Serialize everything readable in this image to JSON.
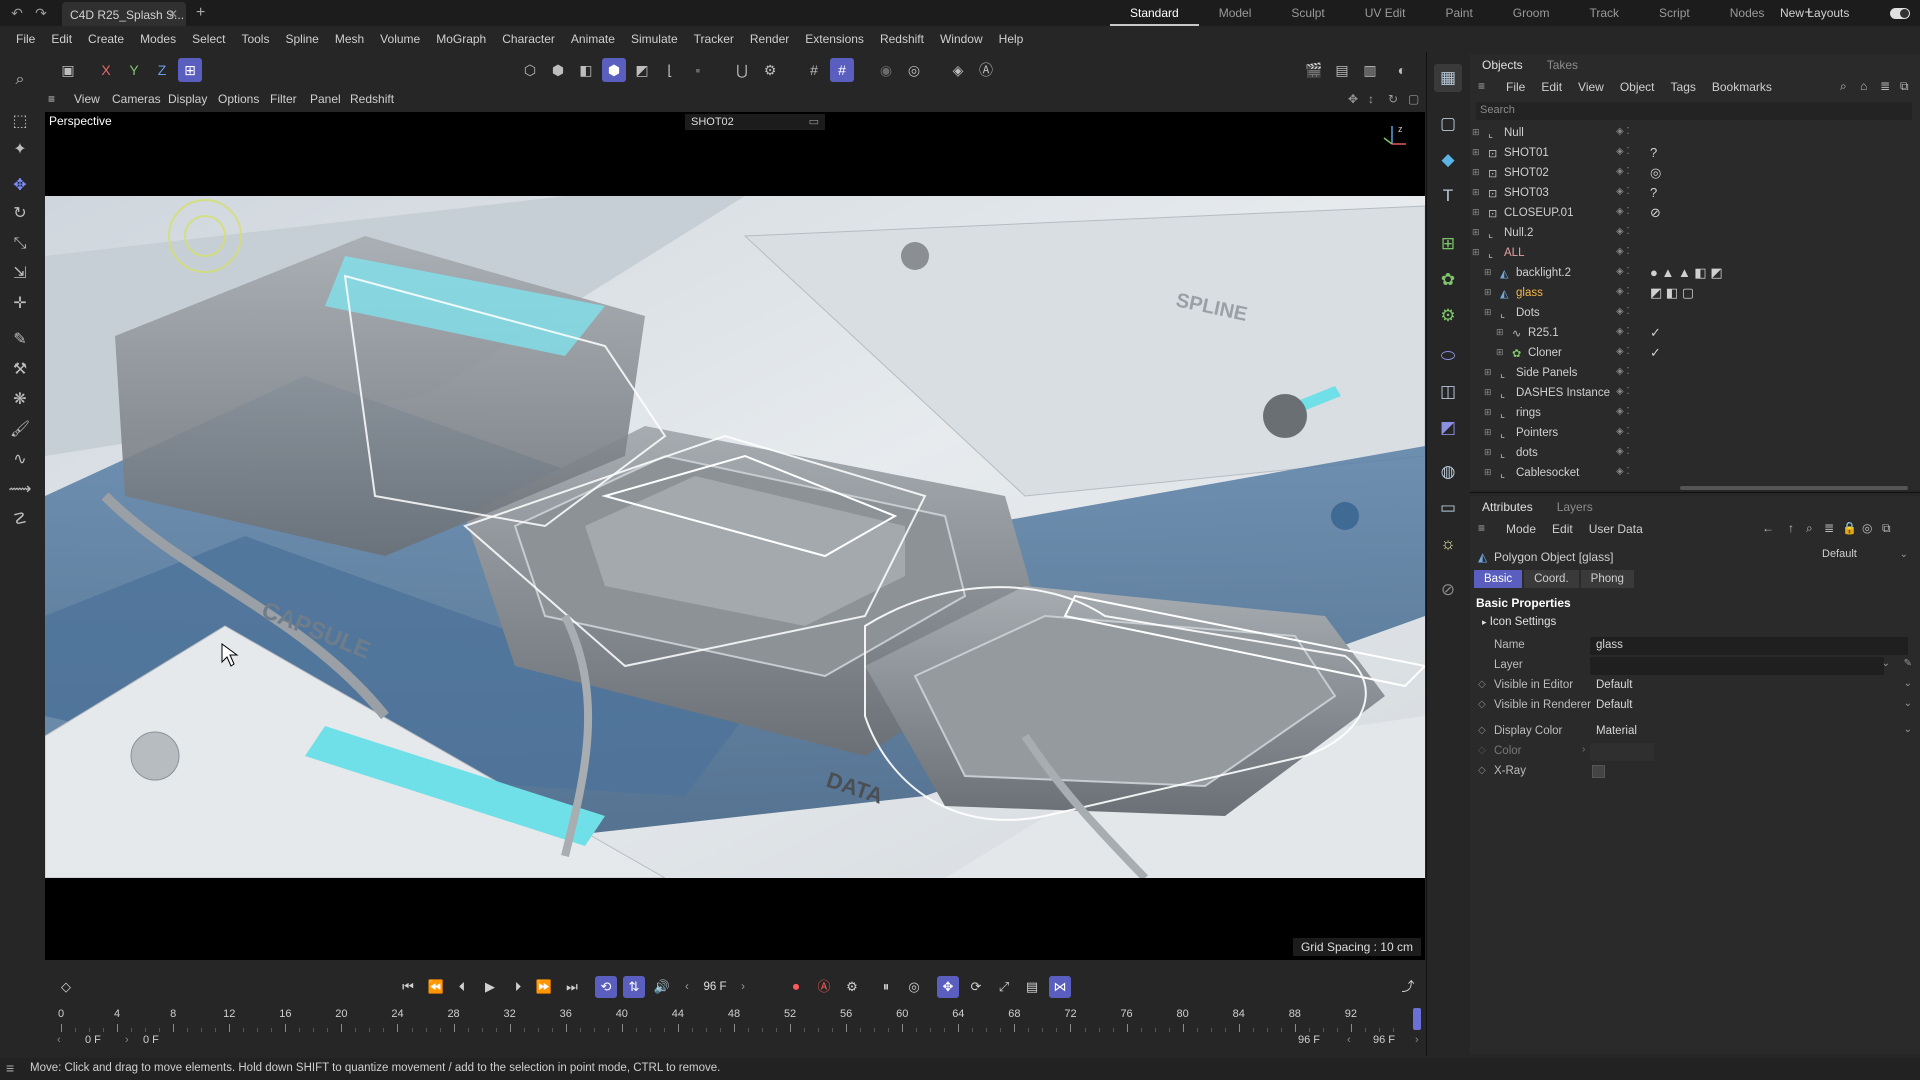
{
  "app": {
    "doc_tab": "C4D R25_Splash S...",
    "layouts": [
      "Standard",
      "Model",
      "Sculpt",
      "UV Edit",
      "Paint",
      "Groom",
      "Track",
      "Script",
      "Nodes"
    ],
    "active_layout": "Standard",
    "new_layouts": "New Layouts"
  },
  "menubar": [
    "File",
    "Edit",
    "Create",
    "Modes",
    "Select",
    "Tools",
    "Spline",
    "Mesh",
    "Volume",
    "MoGraph",
    "Character",
    "Animate",
    "Simulate",
    "Tracker",
    "Render",
    "Extensions",
    "Redshift",
    "Window",
    "Help"
  ],
  "toolbar": {
    "axis_x": "X",
    "axis_y": "Y",
    "axis_z": "Z"
  },
  "viewport": {
    "menu": [
      "View",
      "Cameras",
      "Display",
      "Options",
      "Filter",
      "Panel",
      "Redshift"
    ],
    "label": "Perspective",
    "camera": "SHOT02",
    "grid_spacing": "Grid Spacing : 10 cm",
    "scene_text_1": "CAPSULE",
    "scene_text_2": "DATA",
    "scene_text_3": "SPLINE"
  },
  "objects_panel": {
    "tabs": [
      "Objects",
      "Takes"
    ],
    "menu": [
      "File",
      "Edit",
      "View",
      "Object",
      "Tags",
      "Bookmarks"
    ],
    "search_placeholder": "Search",
    "items": [
      {
        "name": "Null",
        "indent": 0,
        "icon": "null"
      },
      {
        "name": "SHOT01",
        "indent": 0,
        "icon": "camera",
        "tag": "?"
      },
      {
        "name": "SHOT02",
        "indent": 0,
        "icon": "camera",
        "tag": "◎"
      },
      {
        "name": "SHOT03",
        "indent": 0,
        "icon": "camera",
        "tag": "?"
      },
      {
        "name": "CLOSEUP.01",
        "indent": 0,
        "icon": "camera",
        "tag": "⊘"
      },
      {
        "name": "Null.2",
        "indent": 0,
        "icon": "null"
      },
      {
        "name": "ALL",
        "indent": 0,
        "icon": "null",
        "collapsed": false,
        "highlight": true
      },
      {
        "name": "backlight.2",
        "indent": 1,
        "icon": "mesh",
        "tag": "● ▲ ▲ ◧ ◩"
      },
      {
        "name": "glass",
        "indent": 1,
        "icon": "mesh",
        "selected": true,
        "tag": "◩ ◧ ▢"
      },
      {
        "name": "Dots",
        "indent": 1,
        "icon": "null"
      },
      {
        "name": "R25.1",
        "indent": 2,
        "icon": "spline",
        "tag": "✓"
      },
      {
        "name": "Cloner",
        "indent": 2,
        "icon": "cloner",
        "tag": "✓"
      },
      {
        "name": "Side Panels",
        "indent": 1,
        "icon": "null"
      },
      {
        "name": "DASHES Instance",
        "indent": 1,
        "icon": "null"
      },
      {
        "name": "rings",
        "indent": 1,
        "icon": "null"
      },
      {
        "name": "Pointers",
        "indent": 1,
        "icon": "null"
      },
      {
        "name": "dots",
        "indent": 1,
        "icon": "null"
      },
      {
        "name": "Cablesocket",
        "indent": 1,
        "icon": "null"
      }
    ]
  },
  "attributes_panel": {
    "tabs": [
      "Attributes",
      "Layers"
    ],
    "menu": [
      "Mode",
      "Edit",
      "User Data"
    ],
    "object_title": "Polygon Object [glass]",
    "mode_value": "Default",
    "sub_tabs": [
      "Basic",
      "Coord.",
      "Phong"
    ],
    "section": "Basic Properties",
    "subsection": "Icon Settings",
    "fields": [
      {
        "label": "Name",
        "value": "glass"
      },
      {
        "label": "Layer",
        "value": ""
      },
      {
        "label": "Visible in Editor",
        "value": "Default"
      },
      {
        "label": "Visible in Renderer",
        "value": "Default"
      },
      {
        "label": "Display Color",
        "value": "Material"
      },
      {
        "label": "Color",
        "value": ""
      },
      {
        "label": "X-Ray",
        "value": ""
      }
    ]
  },
  "timeline": {
    "current_frame": "96 F",
    "ticks": [
      "0",
      "4",
      "8",
      "12",
      "16",
      "20",
      "24",
      "28",
      "32",
      "36",
      "40",
      "44",
      "48",
      "52",
      "56",
      "60",
      "64",
      "68",
      "72",
      "76",
      "80",
      "84",
      "88",
      "92"
    ],
    "range_start": "0 F",
    "range_start2": "0 F",
    "range_end": "96 F",
    "range_end2": "96 F"
  },
  "status": {
    "text": "Move: Click and drag to move elements. Hold down SHIFT to quantize movement / add to the selection in point mode, CTRL to remove."
  },
  "colors": {
    "accent": "#5a5fbf",
    "selection": "#f4b64a",
    "background": "#262626"
  }
}
